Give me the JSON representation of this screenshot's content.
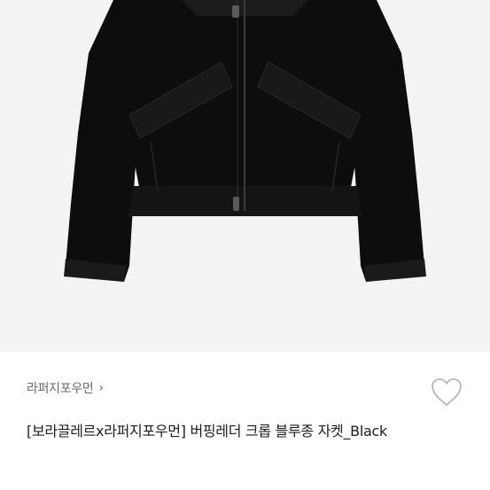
{
  "product": {
    "image_alt": "Black crop blouson jacket",
    "brand_label": "라퍼지포우먼",
    "brand_chevron": "›",
    "wish_icon": "heart-outline-icon",
    "title": "[보라끌레르x라퍼지포우먼] 버핑레더 크롭 블루종 자켓_Black"
  },
  "colors": {
    "image_background": "#f3f3f3",
    "jacket": "#0d0d0d",
    "brand_text": "#6b6b6b",
    "title_text": "#1c1c1c",
    "heart_stroke": "#b0b0b0"
  }
}
